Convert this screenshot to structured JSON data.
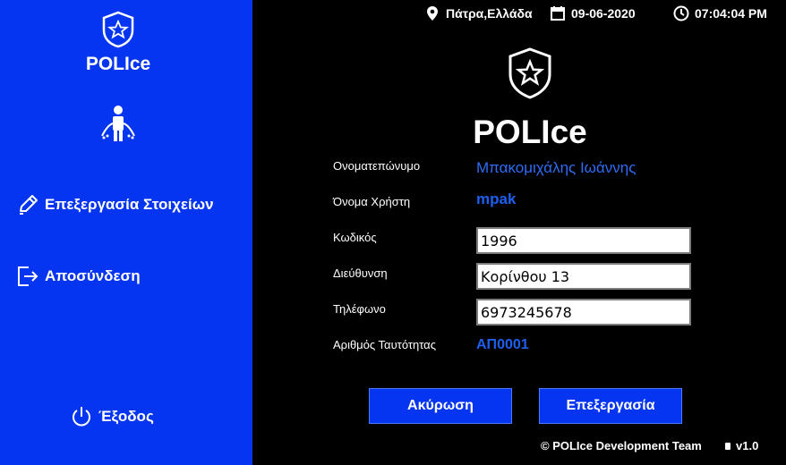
{
  "sidebar": {
    "brand": "POLIce",
    "items": [
      {
        "label": "Επεξεργασία Στοιχείων",
        "icon": "pencil-icon"
      },
      {
        "label": "Αποσύνδεση",
        "icon": "logout-icon"
      }
    ],
    "exit_label": "Έξοδος",
    "bg_color": "#0535f0"
  },
  "topbar": {
    "location": "Πάτρα,Ελλάδα",
    "date": "09-06-2020",
    "time": "07:04:04 PM"
  },
  "main": {
    "title": "POLIce"
  },
  "form": {
    "fullname_label": "Ονοματεπώνυμο",
    "fullname_value": "Μπακομιχάλης Ιωάννης",
    "username_label": "Όνομα Χρήστη",
    "username_value": "mpak",
    "password_label": "Κωδικός",
    "password_value": "1996",
    "address_label": "Διεύθυνση",
    "address_value": "Κορίνθου 13",
    "phone_label": "Τηλέφωνο",
    "phone_value": "6973245678",
    "idnum_label": "Αριθμός Ταυτότητας",
    "idnum_value": "ΑΠ0001"
  },
  "buttons": {
    "cancel": "Ακύρωση",
    "edit": "Επεξεργασία"
  },
  "footer": {
    "copyright": "© POLIce Development Team",
    "version": "v1.0"
  }
}
